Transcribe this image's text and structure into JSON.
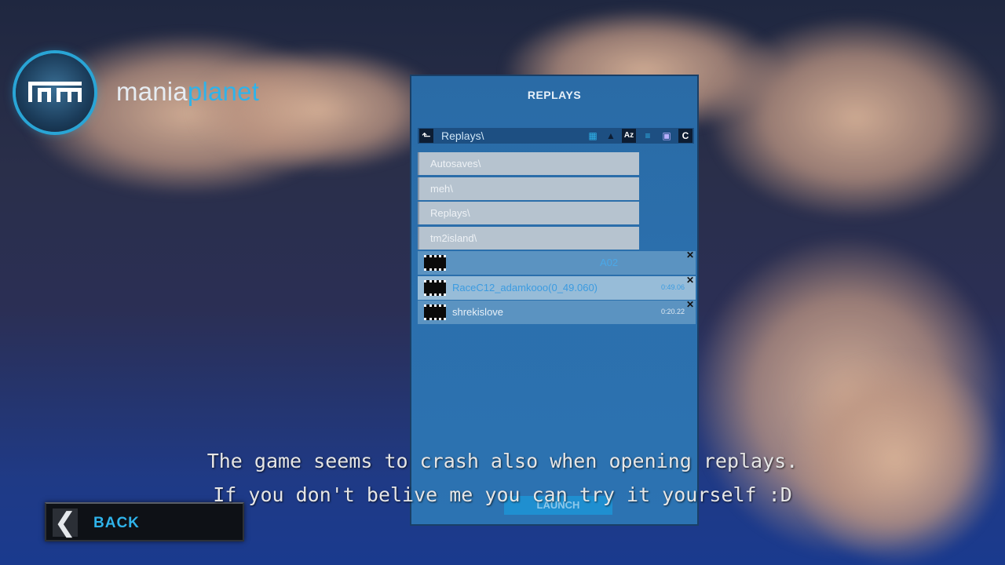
{
  "brand": {
    "part1": "mania",
    "part2": "planet"
  },
  "panel": {
    "title": "REPLAYS",
    "path": "Replays\\",
    "folders": [
      "Autosaves\\",
      "meh\\",
      "Replays\\",
      "tm2island\\"
    ],
    "files": [
      {
        "name": "",
        "extra": "A02",
        "time": ""
      },
      {
        "name": "RaceC12_adamkooo(0_49.060)",
        "extra": "",
        "time": "0:49.06"
      },
      {
        "name": "shrekislove",
        "extra": "",
        "time": "0:20.22"
      }
    ],
    "launch_label": "LAUNCH"
  },
  "back_label": "BACK",
  "subtitles": [
    "The game seems to crash also when opening replays.",
    "If you don't belive me you can try it yourself :D"
  ],
  "colors": {
    "accent": "#2fb3ea",
    "panel": "#2b6fac"
  }
}
